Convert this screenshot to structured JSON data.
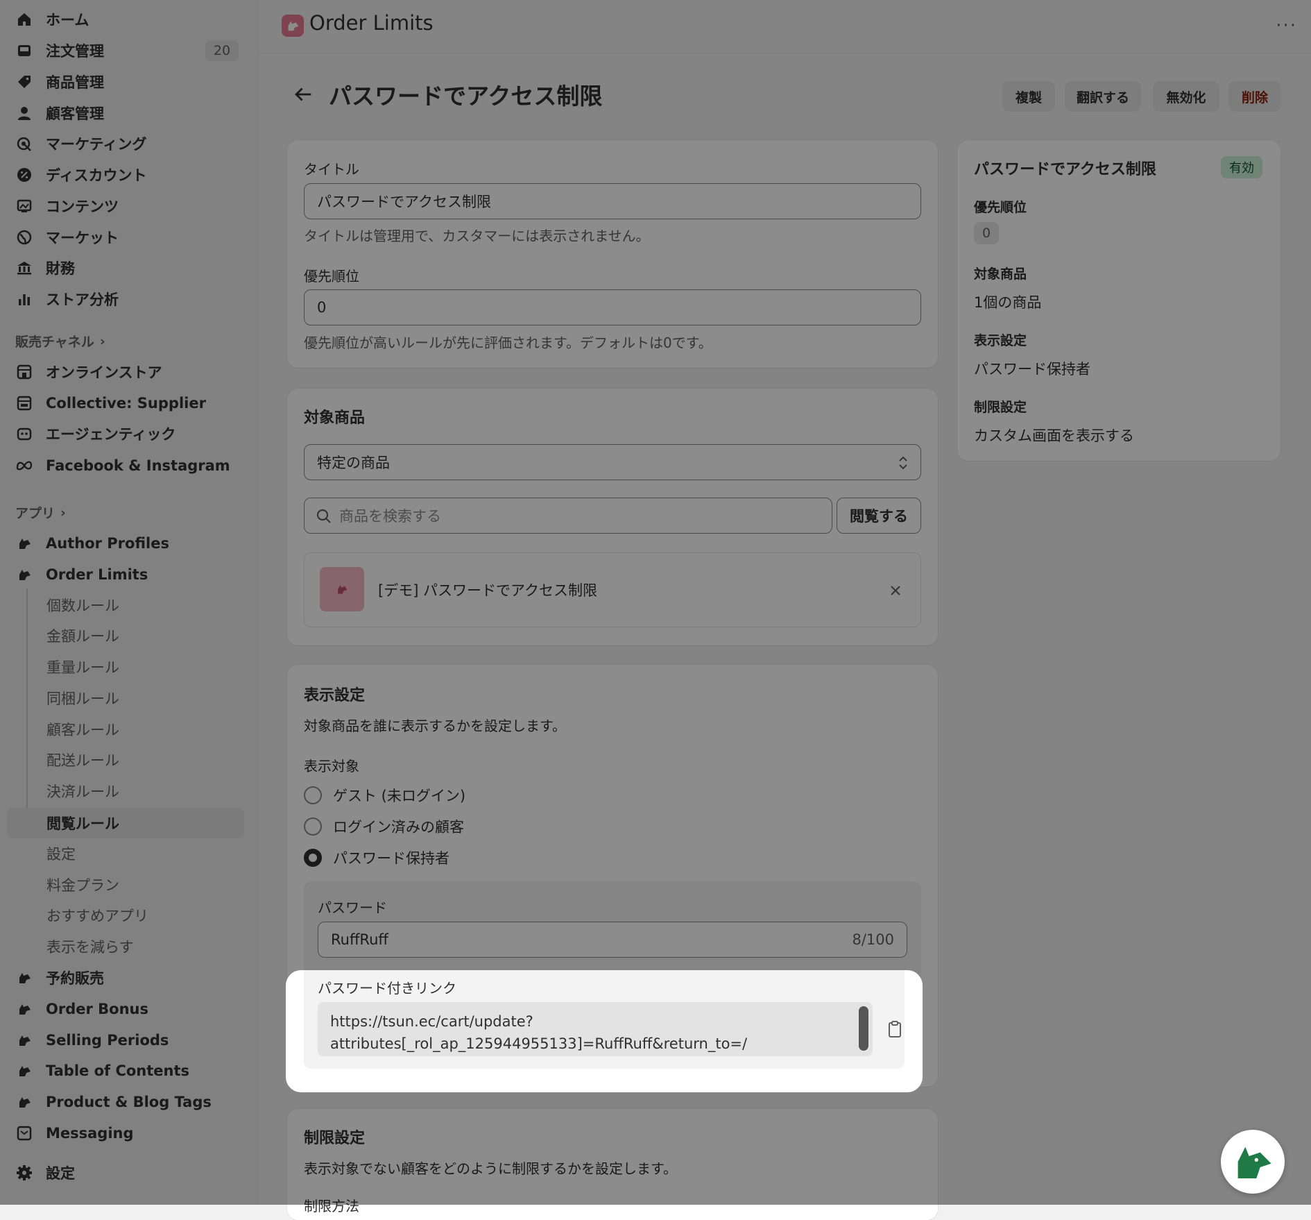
{
  "topbar": {
    "app_title": "Order Limits",
    "more": "···"
  },
  "sidebar": {
    "main_items": [
      {
        "label": "ホーム"
      },
      {
        "label": "注文管理",
        "badge": "20"
      },
      {
        "label": "商品管理"
      },
      {
        "label": "顧客管理"
      },
      {
        "label": "マーケティング"
      },
      {
        "label": "ディスカウント"
      },
      {
        "label": "コンテンツ"
      },
      {
        "label": "マーケット"
      },
      {
        "label": "財務"
      },
      {
        "label": "ストア分析"
      }
    ],
    "channels_title": "販売チャネル",
    "channels": [
      {
        "label": "オンラインストア"
      },
      {
        "label": "Collective: Supplier"
      },
      {
        "label": "エージェンティック"
      },
      {
        "label": "Facebook & Instagram"
      }
    ],
    "apps_title": "アプリ",
    "apps": [
      {
        "label": "Author Profiles"
      },
      {
        "label": "Order Limits"
      }
    ],
    "order_limits_sub": [
      {
        "label": "個数ルール"
      },
      {
        "label": "金額ルール"
      },
      {
        "label": "重量ルール"
      },
      {
        "label": "同梱ルール"
      },
      {
        "label": "顧客ルール"
      },
      {
        "label": "配送ルール"
      },
      {
        "label": "決済ルール"
      },
      {
        "label": "閲覧ルール"
      },
      {
        "label": "設定"
      },
      {
        "label": "料金プラン"
      },
      {
        "label": "おすすめアプリ"
      },
      {
        "label": "表示を減らす"
      }
    ],
    "more_apps": [
      {
        "label": "予約販売"
      },
      {
        "label": "Order Bonus"
      },
      {
        "label": "Selling Periods"
      },
      {
        "label": "Table of Contents"
      },
      {
        "label": "Product & Blog Tags"
      },
      {
        "label": "Messaging"
      }
    ],
    "settings": "設定"
  },
  "header": {
    "title": "パスワードでアクセス制限",
    "buttons": {
      "duplicate": "複製",
      "translate": "翻訳する",
      "disable": "無効化",
      "delete": "削除"
    }
  },
  "general": {
    "title_label": "タイトル",
    "title_value": "パスワードでアクセス制限",
    "title_help": "タイトルは管理用で、カスタマーには表示されません。",
    "priority_label": "優先順位",
    "priority_value": "0",
    "priority_help": "優先順位が高いルールが先に評価されます。デフォルトは0です。"
  },
  "products": {
    "heading": "対象商品",
    "select_value": "特定の商品",
    "search_placeholder": "商品を検索する",
    "browse": "閲覧する",
    "item_name": "[デモ] パスワードでアクセス制限"
  },
  "display": {
    "heading": "表示設定",
    "description": "対象商品を誰に表示するかを設定します。",
    "target_label": "表示対象",
    "options": [
      "ゲスト (未ログイン)",
      "ログイン済みの顧客",
      "パスワード保持者"
    ],
    "selected": "パスワード保持者",
    "password_label": "パスワード",
    "password_value": "RuffRuff",
    "password_count": "8/100",
    "link_label": "パスワード付きリンク",
    "link_line1": "https://tsun.ec/cart/update?",
    "link_line2": "attributes[_rol_ap_125944955133]=RuffRuff&return_to=/"
  },
  "restriction": {
    "heading": "制限設定",
    "description": "表示対象でない顧客をどのように制限するかを設定します。",
    "method_label": "制限方法"
  },
  "summary": {
    "title": "パスワードでアクセス制限",
    "status": "有効",
    "priority_label": "優先順位",
    "priority_value": "0",
    "products_label": "対象商品",
    "products_value": "1個の商品",
    "display_label": "表示設定",
    "display_value": "パスワード保持者",
    "restriction_label": "制限設定",
    "restriction_value": "カスタム画面を表示する"
  }
}
